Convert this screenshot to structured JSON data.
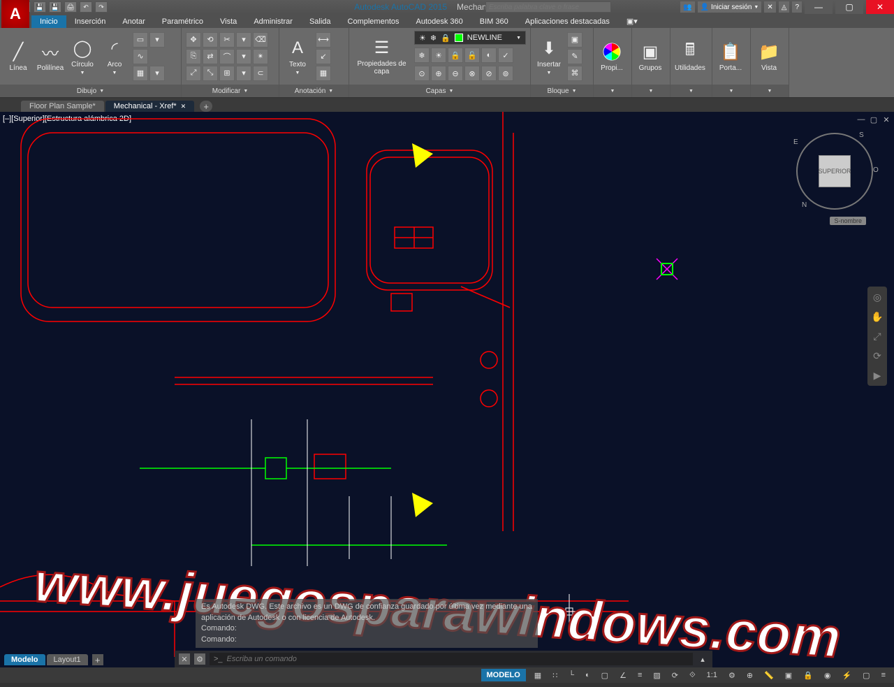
{
  "title": {
    "app": "Autodesk AutoCAD 2015",
    "file": "Mechanical - Xref.dwg",
    "search_placeholder": "Escriba palabra clave o frase",
    "signin": "Iniciar sesión"
  },
  "ribbon": {
    "tabs": [
      "Inicio",
      "Inserción",
      "Anotar",
      "Paramétrico",
      "Vista",
      "Administrar",
      "Salida",
      "Complementos",
      "Autodesk 360",
      "BIM 360",
      "Aplicaciones destacadas"
    ],
    "draw": {
      "line": "Línea",
      "polyline": "Polilínea",
      "circle": "Círculo",
      "arc": "Arco",
      "panel_title": "Dibujo"
    },
    "modify": {
      "panel_title": "Modificar"
    },
    "annotation": {
      "text": "Texto",
      "panel_title": "Anotación"
    },
    "layers": {
      "properties": "Propiedades de capa",
      "current_layer": "NEWLINE",
      "panel_title": "Capas"
    },
    "block": {
      "insert": "Insertar",
      "panel_title": "Bloque"
    },
    "properties": {
      "label": "Propi...",
      "panel_title": ""
    },
    "groups": {
      "label": "Grupos",
      "panel_title": ""
    },
    "utilities": {
      "label": "Utilidades",
      "panel_title": ""
    },
    "clipboard": {
      "label": "Porta...",
      "panel_title": ""
    },
    "view": {
      "label": "Vista",
      "panel_title": ""
    }
  },
  "doc_tabs": [
    {
      "label": "Floor Plan Sample*",
      "active": false
    },
    {
      "label": "Mechanical - Xref*",
      "active": true
    }
  ],
  "viewport": {
    "label": "[–][Superior][Estructura alámbrica 2D]",
    "viewcube_face": "SUPERIOR",
    "viewcube_dirs": {
      "n": "N",
      "s": "S",
      "e": "E",
      "o": "O"
    },
    "wcs_label": "S-nombre"
  },
  "watermark": "www.juegosparawindows.com",
  "command": {
    "history": [
      "Es Autodesk DWG. Este archivo es un DWG de confianza guardado por última vez mediante una",
      "aplicación de Autodesk o con licencia de Autodesk.",
      "Comando:",
      "Comando:"
    ],
    "placeholder": "Escriba un comando",
    "prompt": ">_"
  },
  "layout_tabs": [
    {
      "label": "Modelo",
      "active": true
    },
    {
      "label": "Layout1",
      "active": false
    }
  ],
  "status": {
    "modelo": "MODELO",
    "scale": "1:1",
    "decimal": "▾"
  }
}
